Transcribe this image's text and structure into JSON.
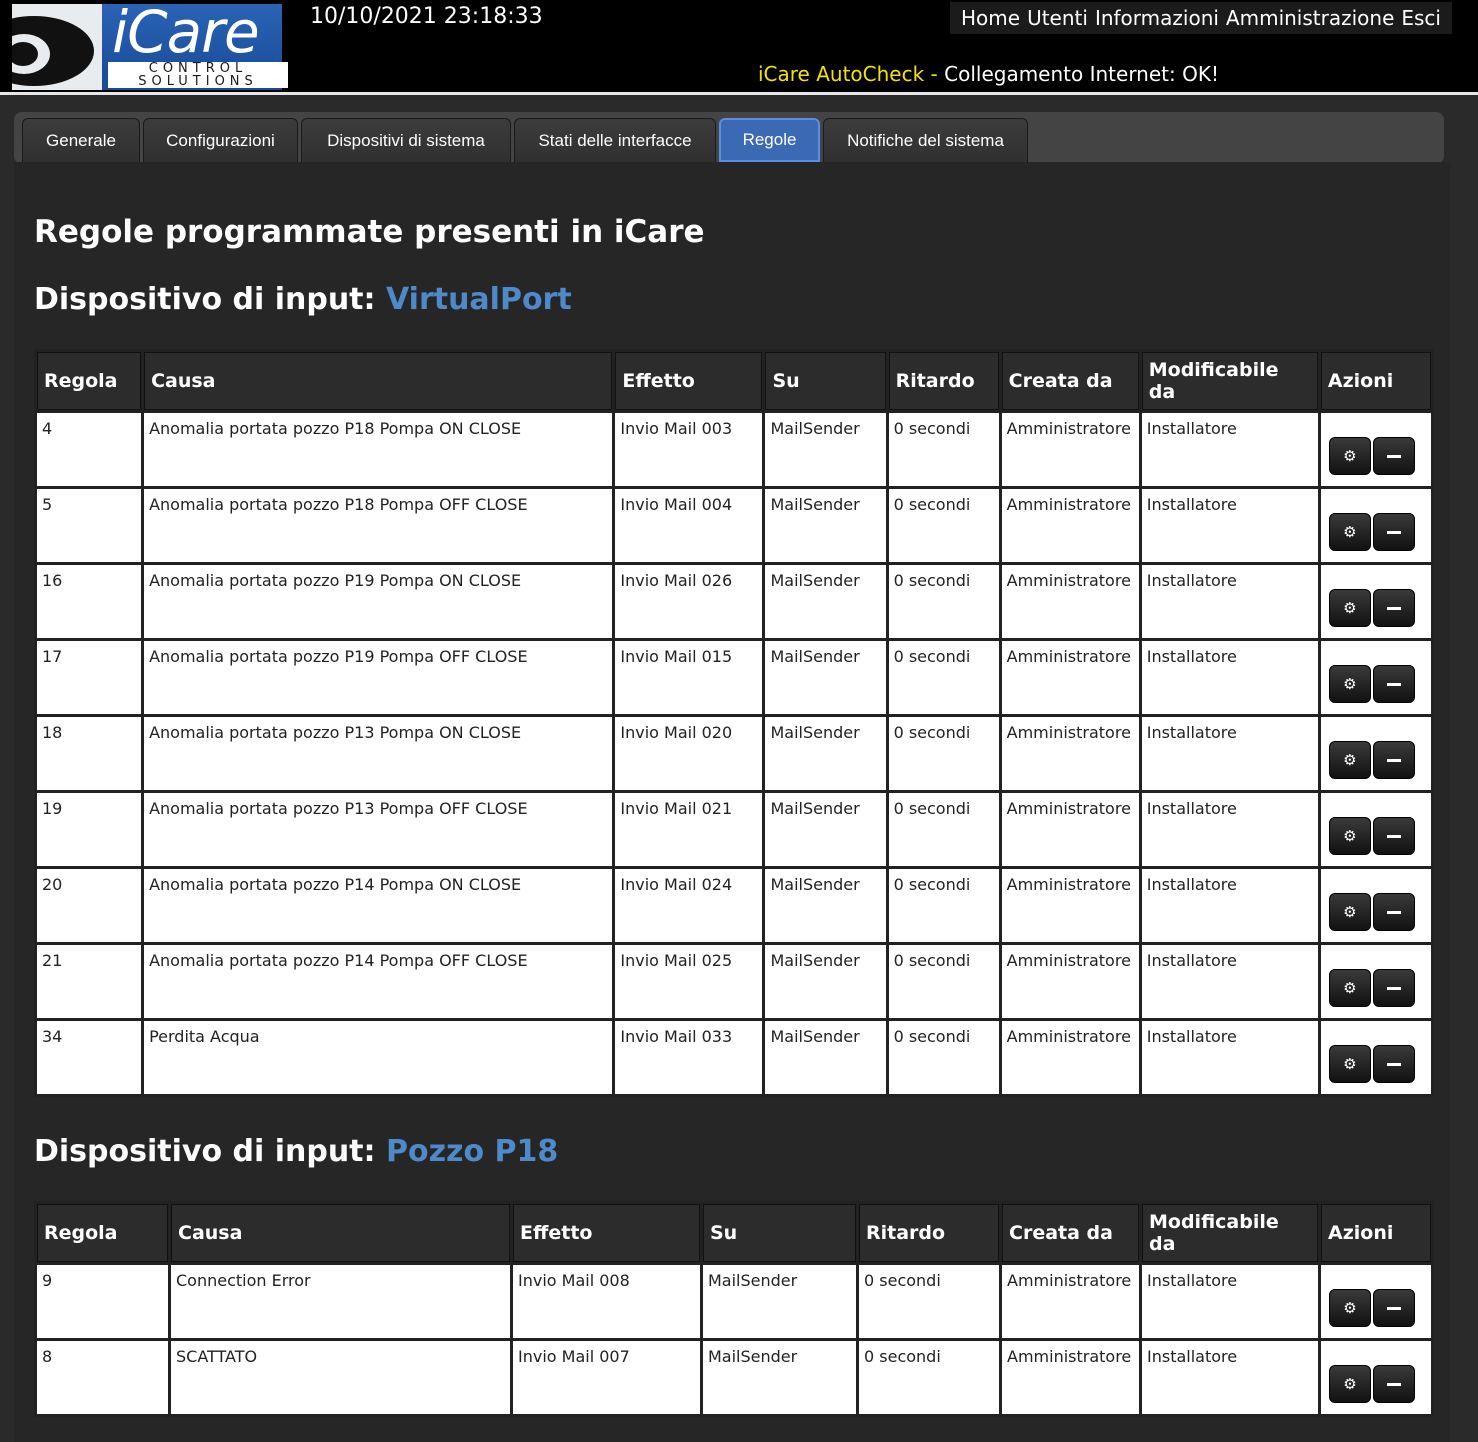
{
  "header": {
    "logo_big": "iCare",
    "logo_line1": "CONTROL",
    "logo_line2": "SOLUTIONS",
    "datetime": "10/10/2021 23:18:33",
    "nav": [
      "Home",
      "Utenti",
      "Informazioni",
      "Amministrazione",
      "Esci"
    ],
    "autocheck_title": "iCare AutoCheck - ",
    "autocheck_text": "Collegamento Internet: OK!"
  },
  "tabs": [
    {
      "label": "Generale"
    },
    {
      "label": "Configurazioni"
    },
    {
      "label": "Dispositivi di sistema"
    },
    {
      "label": "Stati delle interfacce"
    },
    {
      "label": "Regole",
      "active": true
    },
    {
      "label": "Notifiche del sistema"
    }
  ],
  "page_title": "Regole programmate presenti in iCare",
  "section_prefix": "Dispositivo di input: ",
  "columns": [
    "Regola",
    "Causa",
    "Effetto",
    "Su",
    "Ritardo",
    "Creata da",
    "Modificabile da",
    "Azioni"
  ],
  "sections": [
    {
      "device": "VirtualPort",
      "rows": [
        [
          "4",
          "Anomalia portata pozzo P18 Pompa ON CLOSE",
          "Invio Mail 003",
          "MailSender",
          "0 secondi",
          "Amministratore",
          "Installatore"
        ],
        [
          "5",
          "Anomalia portata pozzo P18 Pompa OFF CLOSE",
          "Invio Mail 004",
          "MailSender",
          "0 secondi",
          "Amministratore",
          "Installatore"
        ],
        [
          "16",
          "Anomalia portata pozzo P19 Pompa ON CLOSE",
          "Invio Mail 026",
          "MailSender",
          "0 secondi",
          "Amministratore",
          "Installatore"
        ],
        [
          "17",
          "Anomalia portata pozzo P19 Pompa OFF CLOSE",
          "Invio Mail 015",
          "MailSender",
          "0 secondi",
          "Amministratore",
          "Installatore"
        ],
        [
          "18",
          "Anomalia portata pozzo P13 Pompa ON CLOSE",
          "Invio Mail 020",
          "MailSender",
          "0 secondi",
          "Amministratore",
          "Installatore"
        ],
        [
          "19",
          "Anomalia portata pozzo P13 Pompa OFF CLOSE",
          "Invio Mail 021",
          "MailSender",
          "0 secondi",
          "Amministratore",
          "Installatore"
        ],
        [
          "20",
          "Anomalia portata pozzo P14 Pompa ON CLOSE",
          "Invio Mail 024",
          "MailSender",
          "0 secondi",
          "Amministratore",
          "Installatore"
        ],
        [
          "21",
          "Anomalia portata pozzo P14 Pompa OFF CLOSE",
          "Invio Mail 025",
          "MailSender",
          "0 secondi",
          "Amministratore",
          "Installatore"
        ],
        [
          "34",
          "Perdita Acqua",
          "Invio Mail 033",
          "MailSender",
          "0 secondi",
          "Amministratore",
          "Installatore"
        ]
      ]
    },
    {
      "device": "Pozzo P18",
      "rows": [
        [
          "9",
          "Connection Error",
          "Invio Mail 008",
          "MailSender",
          "0 secondi",
          "Amministratore",
          "Installatore"
        ],
        [
          "8",
          "SCATTATO",
          "Invio Mail 007",
          "MailSender",
          "0 secondi",
          "Amministratore",
          "Installatore"
        ]
      ]
    }
  ],
  "colors": {
    "accent": "#4e8ac9",
    "tab_active": "#3b69b3",
    "autocheck": "#f2e205"
  },
  "icons": {
    "edit": "gear-icon",
    "delete": "minus-icon"
  }
}
